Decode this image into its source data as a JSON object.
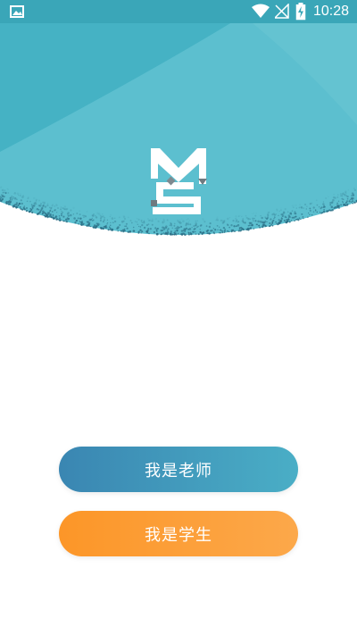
{
  "status_bar": {
    "time": "10:28",
    "icons": [
      "gallery-icon",
      "wifi-icon",
      "no-signal-icon",
      "battery-charging-icon"
    ]
  },
  "colors": {
    "header_teal": "#5cbfcf",
    "status_bar": "#3aa6b8",
    "teacher_button_start": "#3a86b2",
    "teacher_button_end": "#4aaec6",
    "student_button_start": "#fc9628",
    "student_button_end": "#fca84a"
  },
  "logo": {
    "icon": "ms-logo-icon"
  },
  "actions": {
    "teacher_label": "我是老师",
    "student_label": "我是学生"
  }
}
